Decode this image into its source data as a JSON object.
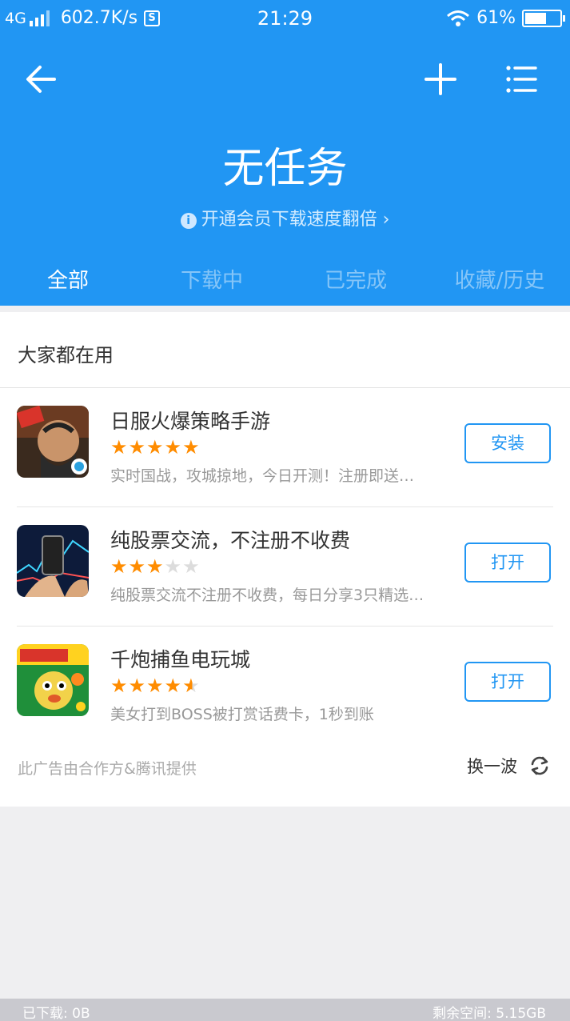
{
  "status_bar": {
    "network": "4G",
    "speed": "602.7K/s",
    "s_badge": "S",
    "time": "21:29",
    "battery": "61%"
  },
  "header": {
    "title": "无任务",
    "vip_info_glyph": "i",
    "vip_promo": "开通会员下载速度翻倍 ›"
  },
  "tabs": [
    {
      "label": "全部",
      "active": true
    },
    {
      "label": "下载中",
      "active": false
    },
    {
      "label": "已完成",
      "active": false
    },
    {
      "label": "收藏/历史",
      "active": false
    }
  ],
  "recommend": {
    "section_title": "大家都在用",
    "apps": [
      {
        "name": "日服火爆策略手游",
        "rating": 5,
        "desc": "实时国战，攻城掠地，今日开测！注册即送…",
        "button": "安装",
        "icon": "game-warrior-icon"
      },
      {
        "name": "纯股票交流，不注册不收费",
        "rating": 3,
        "desc": "纯股票交流不注册不收费，每日分享3只精选…",
        "button": "打开",
        "icon": "stock-chart-icon"
      },
      {
        "name": "千炮捕鱼电玩城",
        "rating": 4.5,
        "desc": "美女打到BOSS被打赏话费卡，1秒到账",
        "button": "打开",
        "icon": "fish-game-icon"
      }
    ],
    "ad_note": "此广告由合作方&腾讯提供",
    "refresh_label": "换一波"
  },
  "footer": {
    "downloaded": "已下载: 0B",
    "free_space": "剩余空间: 5.15GB"
  },
  "colors": {
    "accent": "#2196f3",
    "star": "#ff8c00"
  }
}
